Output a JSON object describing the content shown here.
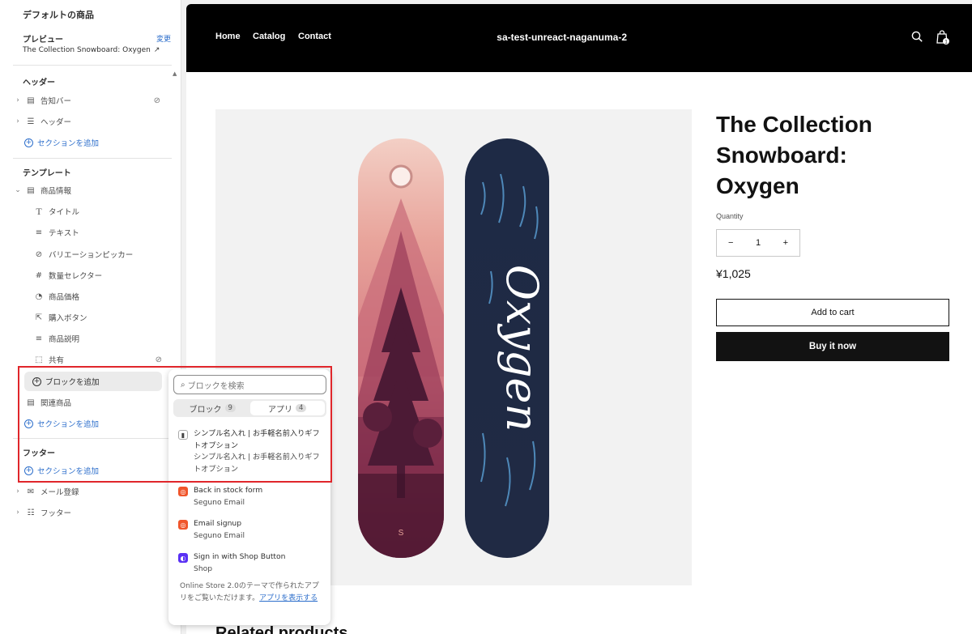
{
  "editor": {
    "page_title": "デフォルトの商品",
    "preview_label": "プレビュー",
    "preview_change": "変更",
    "preview_value": "The Collection Snowboard: Oxygen",
    "header_group": "ヘッダー",
    "header_items": [
      {
        "label": "告知バー",
        "icon": "section-icon",
        "hidden": true
      },
      {
        "label": "ヘッダー",
        "icon": "header-layout-icon",
        "hidden": false
      }
    ],
    "add_section": "セクションを追加",
    "template_group": "テンプレート",
    "product_section": "商品情報",
    "blocks": [
      {
        "label": "タイトル",
        "icon": "title-icon",
        "glyph": "T"
      },
      {
        "label": "テキスト",
        "icon": "text-icon",
        "glyph": "≡"
      },
      {
        "label": "バリエーションピッカー",
        "icon": "variant-icon",
        "glyph": "⊘"
      },
      {
        "label": "数量セレクター",
        "icon": "quantity-icon",
        "glyph": "#"
      },
      {
        "label": "商品価格",
        "icon": "price-tag-icon",
        "glyph": "◔"
      },
      {
        "label": "購入ボタン",
        "icon": "cursor-click-icon",
        "glyph": "⇱"
      },
      {
        "label": "商品説明",
        "icon": "description-icon",
        "glyph": "≡"
      },
      {
        "label": "共有",
        "icon": "share-icon",
        "glyph": "⬚",
        "hidden": true
      }
    ],
    "add_block": "ブロックを追加",
    "related_section": "関連商品",
    "footer_group": "フッター",
    "footer_items": [
      {
        "label": "メール登録",
        "icon": "email-icon"
      },
      {
        "label": "フッター",
        "icon": "footer-layout-icon"
      }
    ]
  },
  "picker": {
    "search_placeholder": "ブロックを検索",
    "tabs": [
      {
        "label": "ブロック",
        "count": "9",
        "active": false
      },
      {
        "label": "アプリ",
        "count": "4",
        "active": true
      }
    ],
    "apps": [
      {
        "title": "シンプル名入れ | お手軽名前入りギフトオプション",
        "vendor": "シンプル名入れ | お手軽名前入りギフトオプション",
        "icon": "app-name-icon",
        "color": "#ffffff"
      },
      {
        "title": "Back in stock form",
        "vendor": "Seguno Email",
        "icon": "seguno-icon",
        "color": "#f0562c"
      },
      {
        "title": "Email signup",
        "vendor": "Seguno Email",
        "icon": "seguno-icon",
        "color": "#f0562c"
      },
      {
        "title": "Sign in with Shop Button",
        "vendor": "Shop",
        "icon": "shop-icon",
        "color": "#5a31f4"
      }
    ],
    "footer_text": "Online Store 2.0のテーマで作られたアプリをご覧いただけます。",
    "footer_link": "アプリを表示する"
  },
  "store": {
    "nav": [
      "Home",
      "Catalog",
      "Contact"
    ],
    "shop_name": "sa-test-unreact-naganuma-2",
    "cart_count": "1",
    "product_title": "The Collection Snowboard: Oxygen",
    "quantity_label": "Quantity",
    "quantity_minus": "−",
    "quantity_value": "1",
    "quantity_plus": "+",
    "price": "¥1,025",
    "add_to_cart": "Add to cart",
    "buy_now": "Buy it now",
    "related_heading": "Related products",
    "board_text": "Oxygen",
    "board_logo": "S"
  },
  "colors": {
    "accent_link": "#2c6ecb",
    "highlight_box": "#e0262b",
    "header_bg": "#000000",
    "buy_button": "#121212"
  }
}
